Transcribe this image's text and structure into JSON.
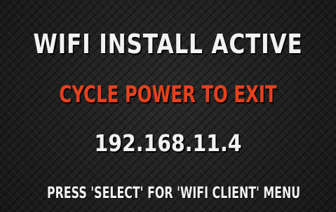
{
  "screen": {
    "title": "WIFI INSTALL ACTIVE",
    "subtitle": "CYCLE POWER TO EXIT",
    "ip_address": "192.168.11.4",
    "hint": "PRESS 'SELECT' FOR 'WIFI CLIENT' MENU",
    "colors": {
      "text": "#f2f2f2",
      "warning": "#e8401c",
      "background": "#1e1e1e"
    }
  }
}
